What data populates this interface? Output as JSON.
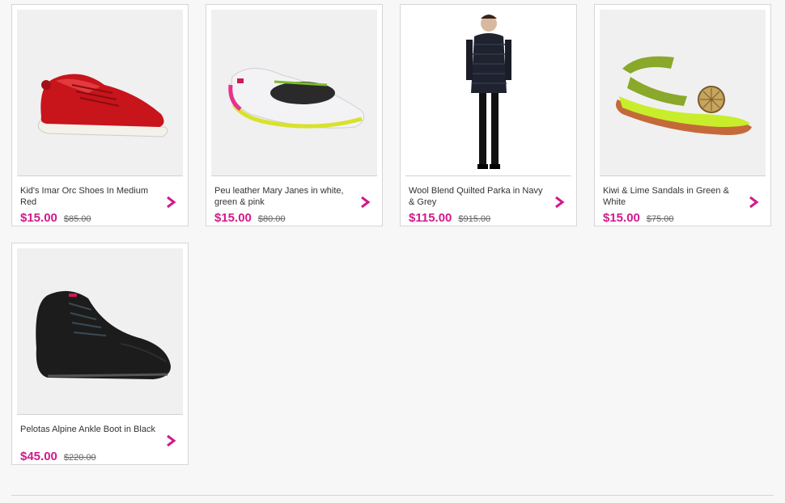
{
  "colors": {
    "accent": "#d11a8c",
    "background": "#f7f7f7",
    "card_border": "#d6d6d6"
  },
  "products": [
    {
      "title": "Kid's Imar Orc Shoes In Medium Red",
      "price": "$15.00",
      "old_price": "$85.00",
      "image_icon": "red-sneaker-image"
    },
    {
      "title": "Peu leather Mary Janes in white, green & pink",
      "price": "$15.00",
      "old_price": "$80.00",
      "image_icon": "white-mary-jane-image"
    },
    {
      "title": "Wool Blend Quilted Parka in Navy & Grey",
      "price": "$115.00",
      "old_price": "$915.00",
      "image_icon": "quilted-parka-image"
    },
    {
      "title": "Kiwi & Lime Sandals in Green & White",
      "price": "$15.00",
      "old_price": "$75.00",
      "image_icon": "kiwi-sandal-image"
    },
    {
      "title": "Pelotas Alpine Ankle Boot in Black",
      "price": "$45.00",
      "old_price": "$220.00",
      "image_icon": "black-ankle-boot-image"
    }
  ]
}
